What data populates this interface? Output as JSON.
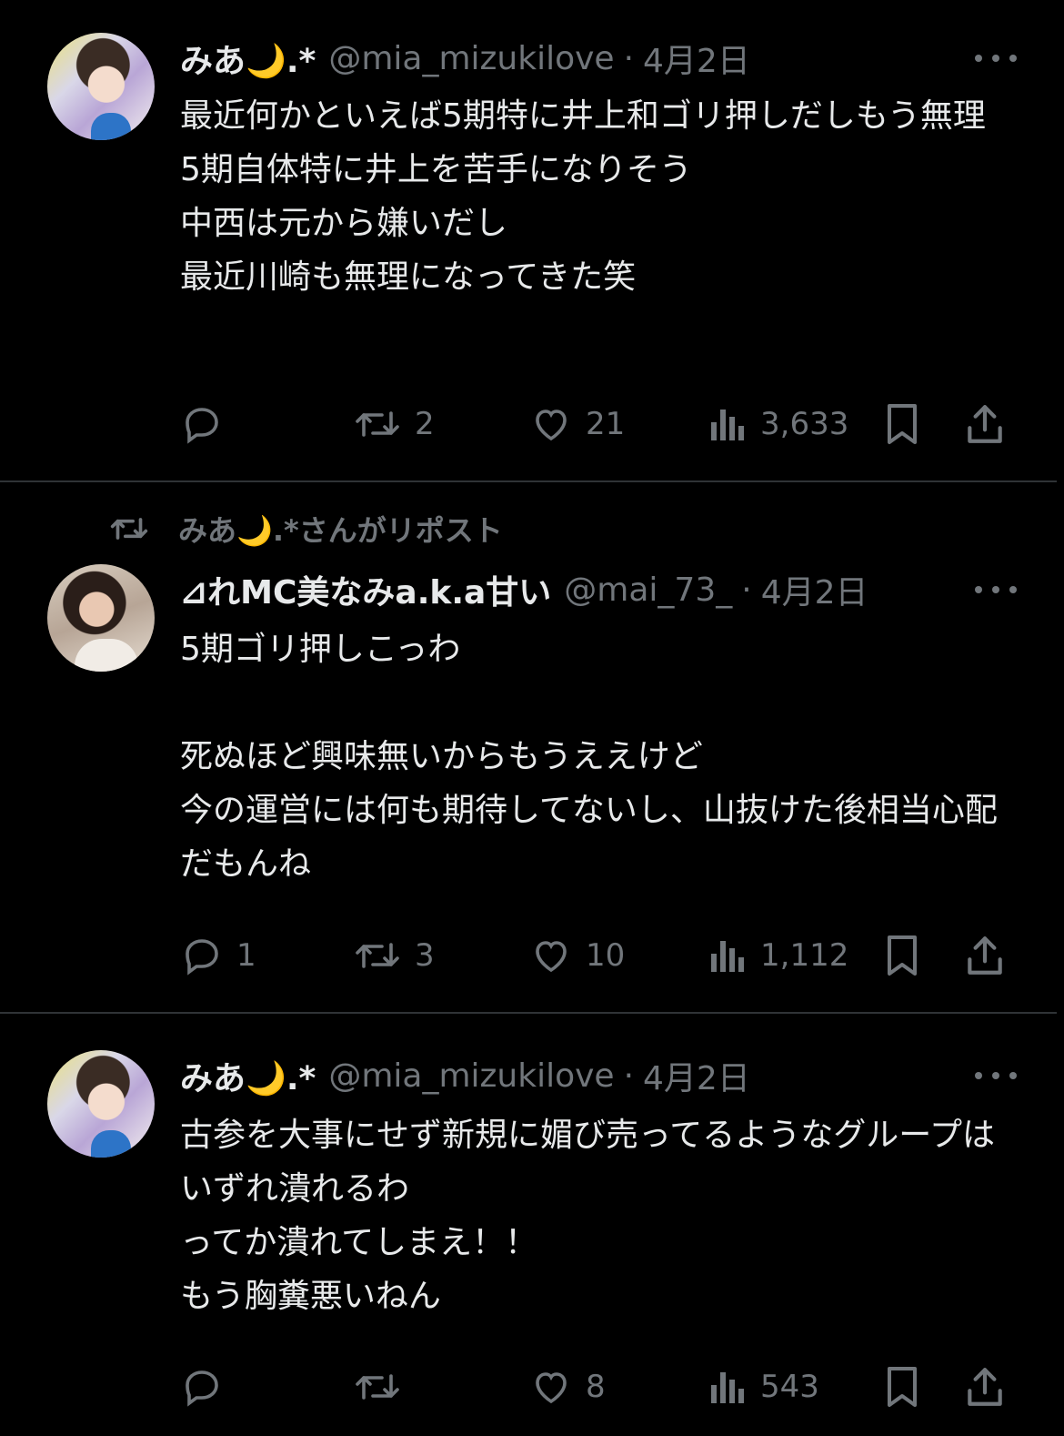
{
  "tweets": [
    {
      "name": "みあ🌙.*",
      "handle": "@mia_mizukilove",
      "dot": "·",
      "date": "4月2日",
      "text": "最近何かといえば5期特に井上和ゴリ押しだしもう無理\n5期自体特に井上を苦手になりそう\n中西は元から嫌いだし\n最近川崎も無理になってきた笑",
      "replies": "",
      "reposts": "2",
      "likes": "21",
      "views": "3,633"
    },
    {
      "repost_label": "みあ🌙.*さんがリポスト",
      "name": "⊿れMC美なみa.k.a甘い",
      "handle": "@mai_73_",
      "dot": "·",
      "date": "4月2日",
      "text": "5期ゴリ押しこっわ\n\n死ぬほど興味無いからもうええけど\n今の運営には何も期待してないし、山抜けた後相当心配だもんね",
      "replies": "1",
      "reposts": "3",
      "likes": "10",
      "views": "1,112"
    },
    {
      "name": "みあ🌙.*",
      "handle": "@mia_mizukilove",
      "dot": "·",
      "date": "4月2日",
      "text": "古参を大事にせず新規に媚び売ってるようなグループはいずれ潰れるわ\nってか潰れてしまえ！！\nもう胸糞悪いねん",
      "replies": "",
      "reposts": "",
      "likes": "8",
      "views": "543"
    }
  ],
  "icons": {
    "reply": "speech-bubble-icon",
    "repost": "repost-arrows-icon",
    "like": "heart-icon",
    "views": "bar-chart-icon",
    "bookmark": "bookmark-icon",
    "share": "share-upload-icon",
    "more": "more-dots-icon"
  },
  "colors": {
    "background": "#000000",
    "text": "#e7e9ea",
    "secondary": "#71767b",
    "divider": "#2f3336"
  }
}
